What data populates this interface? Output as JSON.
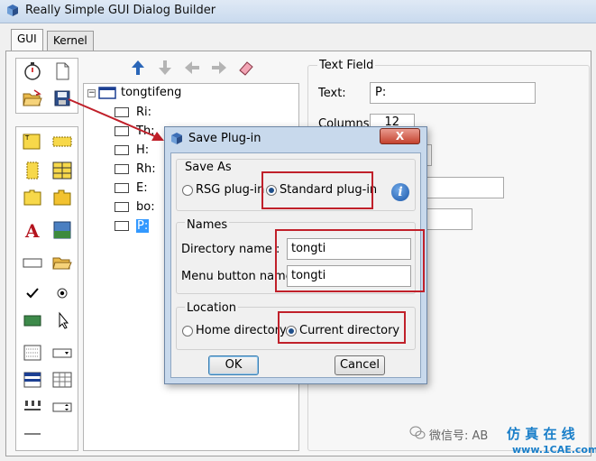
{
  "window": {
    "title": "Really Simple GUI Dialog Builder"
  },
  "tabs": [
    {
      "label": "GUI",
      "active": true
    },
    {
      "label": "Kernel",
      "active": false
    }
  ],
  "palette_top": {
    "icons": [
      "stopwatch-icon",
      "new-document-icon",
      "open-folder-icon",
      "save-disk-icon"
    ]
  },
  "palette_widgets": {
    "icons": [
      "form-icon",
      "frame-icon",
      "vertical-frame-icon",
      "grid-frame-icon",
      "tab-book-icon",
      "tab-item-icon",
      "label-icon",
      "picture-icon",
      "text-field-icon",
      "file-folder-icon",
      "check-box-icon",
      "radio-button-icon",
      "push-button-icon",
      "pick-icon",
      "list-icon",
      "combo-box-icon",
      "table-icon",
      "spreadsheet-icon",
      "slider-icon",
      "spinner-icon",
      "separator-icon"
    ]
  },
  "tree_toolbar": {
    "icons": [
      "up-arrow-icon",
      "down-arrow-icon",
      "left-arrow-icon",
      "right-arrow-icon",
      "eraser-icon"
    ]
  },
  "tree": {
    "root": "tongtifeng",
    "children": [
      "Ri:",
      "Th:",
      "H:",
      "Rh:",
      "E:",
      "bo:",
      "P:"
    ]
  },
  "properties": {
    "section_title": "Text Field",
    "text_label": "Text:",
    "text_value": "P:",
    "columns_label": "Columns:",
    "columns_value": "12"
  },
  "dialog": {
    "title": "Save Plug-in",
    "close_label": "X",
    "save_as": {
      "title": "Save As",
      "options": [
        {
          "label": "RSG plug-in",
          "checked": false
        },
        {
          "label": "Standard plug-in",
          "checked": true
        }
      ],
      "info_glyph": "i"
    },
    "names": {
      "title": "Names",
      "directory_label": "Directory name :",
      "directory_value": "tongti",
      "menu_label": "Menu button name:",
      "menu_value": "tongti"
    },
    "location": {
      "title": "Location",
      "options": [
        {
          "label": "Home directory",
          "checked": false
        },
        {
          "label": "Current directory",
          "checked": true
        }
      ]
    },
    "ok_label": "OK",
    "cancel_label": "Cancel"
  },
  "watermark": {
    "text": "微信号: AB",
    "brand_cn": "仿 真 在 线",
    "brand_url": "www.1CAE.com"
  },
  "colors": {
    "annotation_red": "#c0202a",
    "selection_blue": "#3399ff",
    "dialog_frame": "#c8d9ec"
  }
}
